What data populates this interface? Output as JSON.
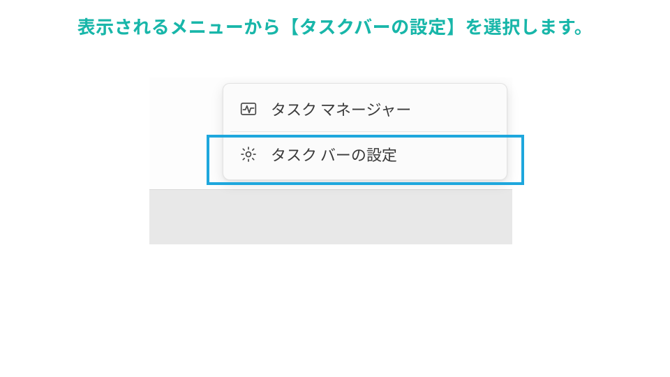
{
  "instruction": "表示されるメニューから【タスクバーの設定】を選択します。",
  "menu": {
    "items": [
      {
        "label": "タスク マネージャー",
        "icon": "activity-icon"
      },
      {
        "label": "タスク バーの設定",
        "icon": "gear-icon"
      }
    ]
  },
  "highlight_color": "#1ea7dd",
  "accent_color": "#18b6a9"
}
